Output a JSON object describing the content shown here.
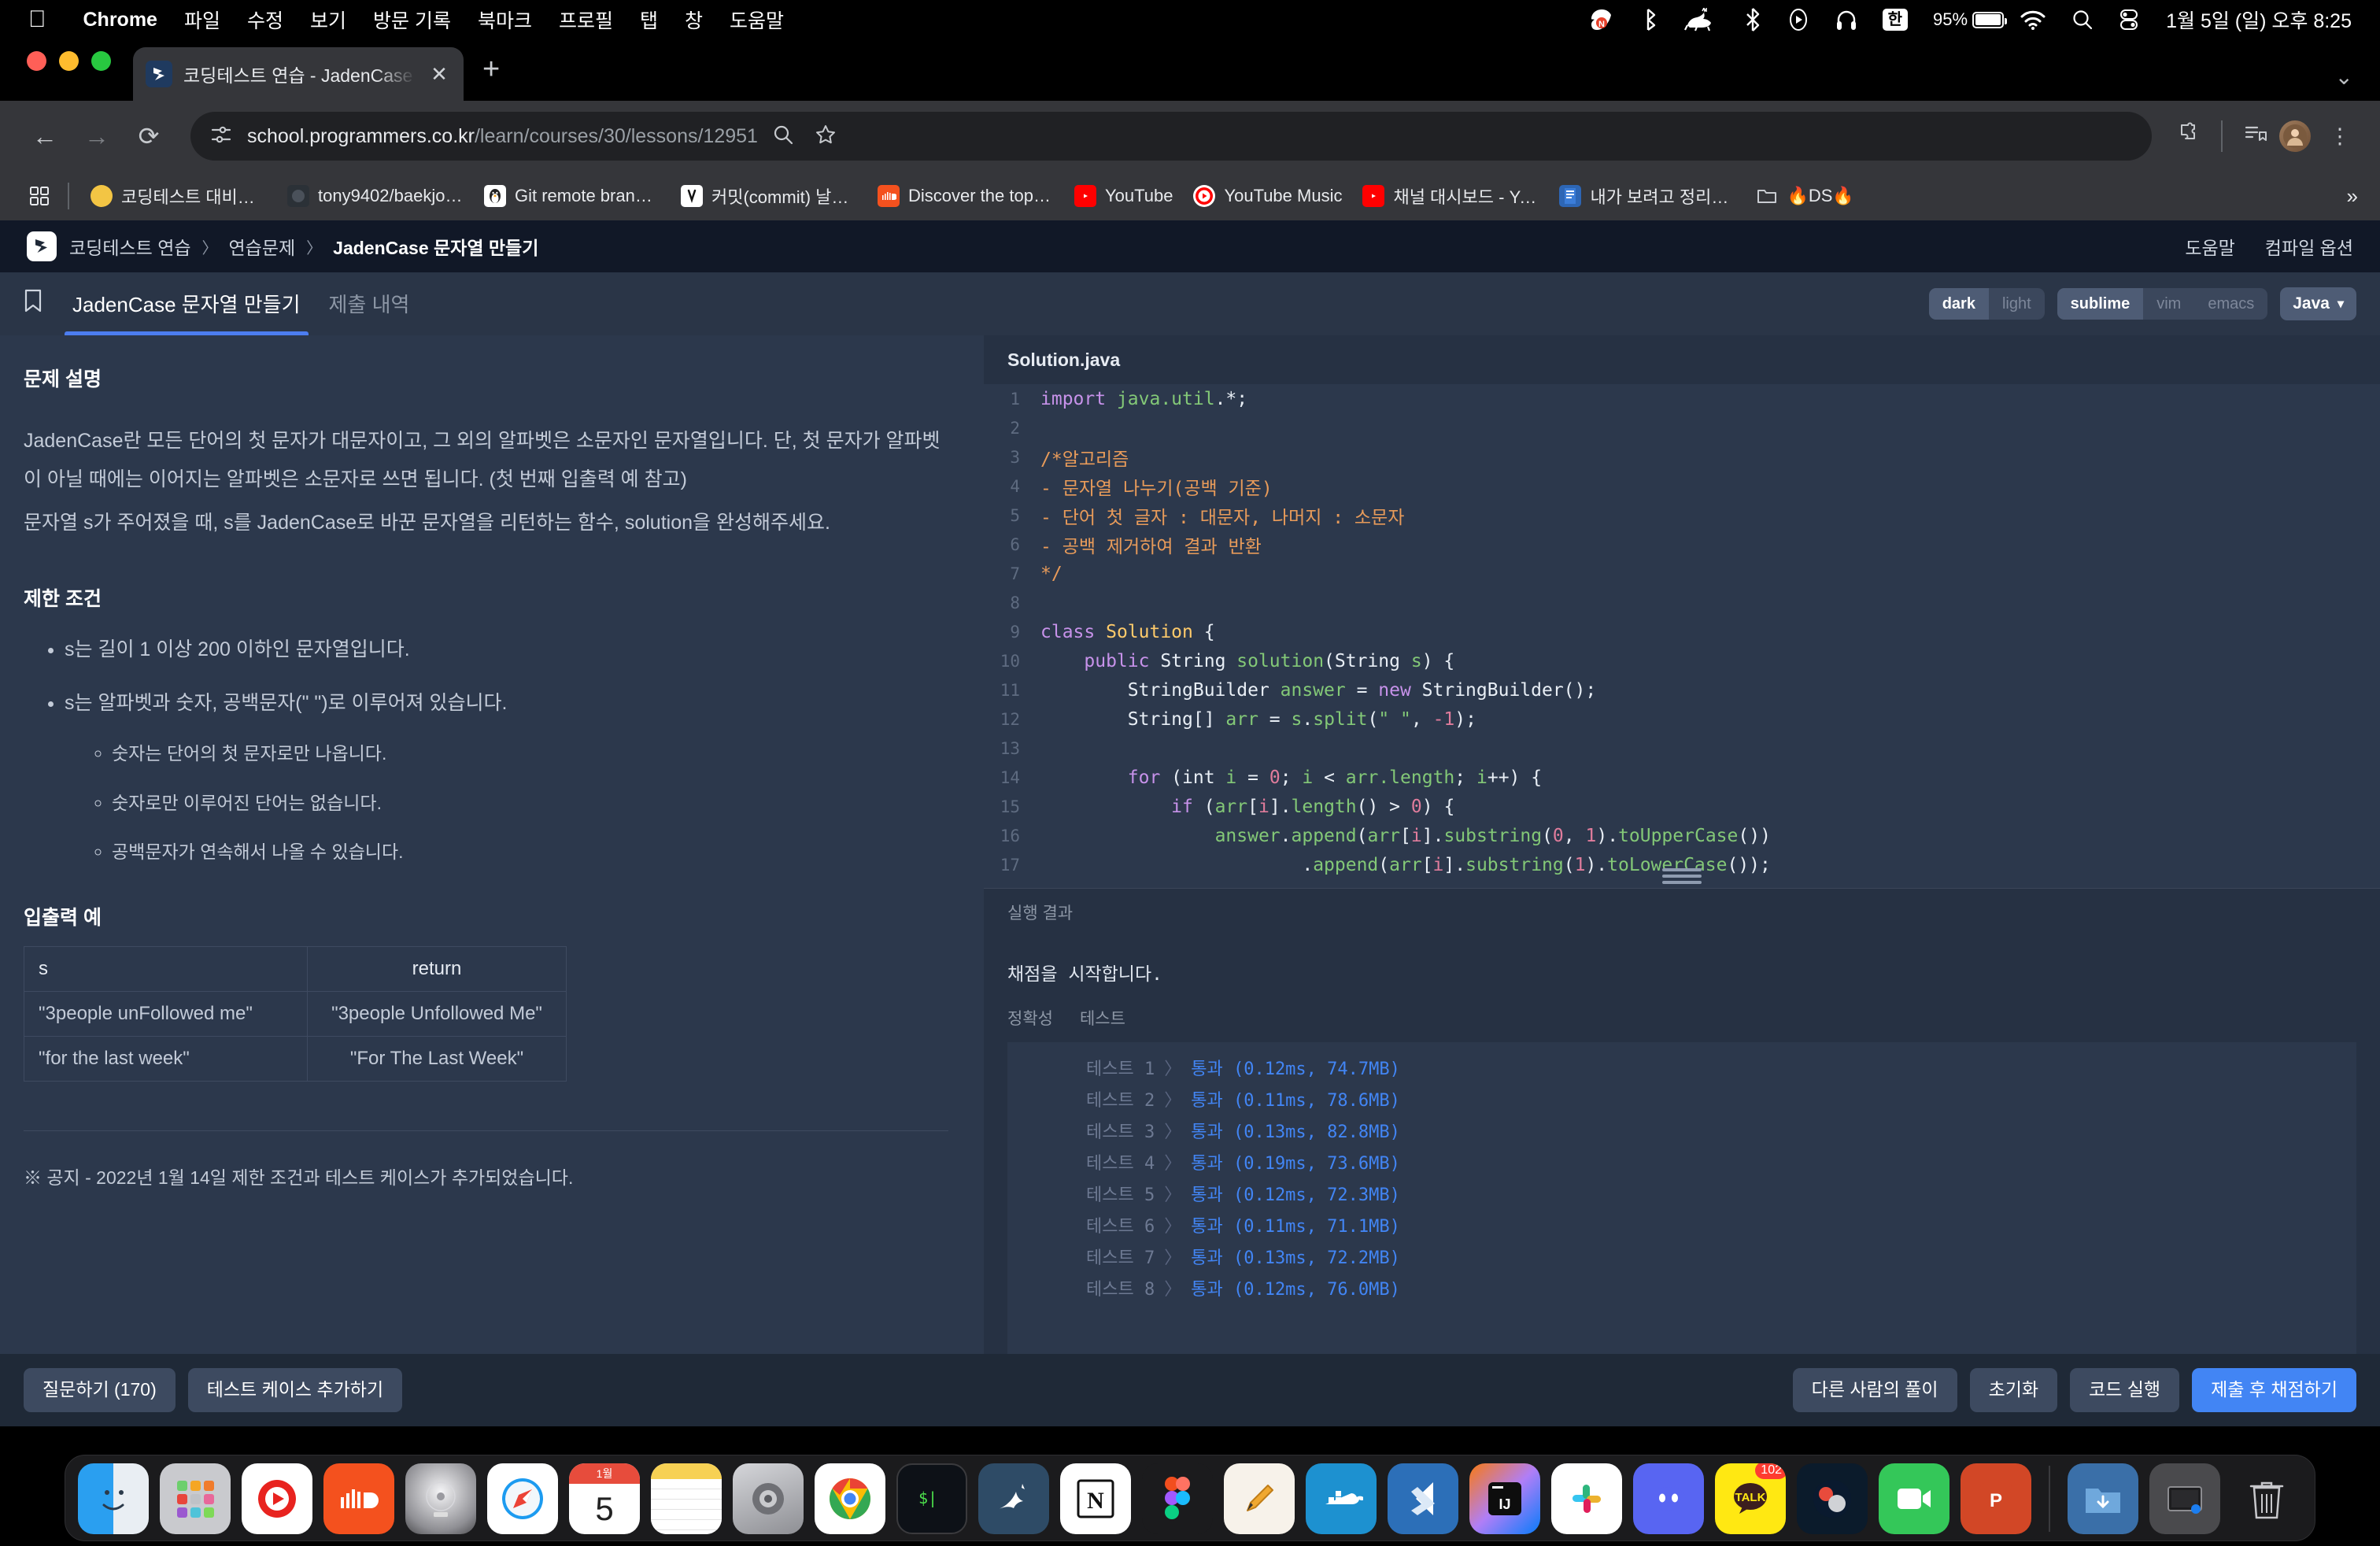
{
  "menubar": {
    "apple_icon": "apple-icon",
    "app_name": "Chrome",
    "items": [
      "파일",
      "수정",
      "보기",
      "방문 기록",
      "북마크",
      "프로필",
      "탭",
      "창",
      "도움말"
    ],
    "status_icons": [
      "naver-whale-icon",
      "bluetooth-tray-icon",
      "cat-runner-icon",
      "bluetooth-icon",
      "play-icon",
      "headphones-icon"
    ],
    "ime": "한",
    "battery_percent": "95%",
    "clock": "1월 5일 (일) 오후 8:25"
  },
  "chrome": {
    "tab": {
      "title": "코딩테스트 연습 - JadenCase 문자열 만들기",
      "close_label": "✕"
    },
    "new_tab_label": "+",
    "window_chevron": "⌄",
    "toolbar": {
      "back": "←",
      "forward": "→",
      "reload": "⟳",
      "url_host": "school.programmers.co.kr",
      "url_path": "/learn/courses/30/lessons/12951",
      "zoom_icon": "search-page-icon",
      "bookmark_icon": "star-icon",
      "extensions_icon": "puzzle-icon",
      "readinglist_icon": "reading-list-icon",
      "profile_initial": "",
      "menu_icon": "⋮"
    },
    "bookmarks": [
      {
        "label": "코딩테스트 대비를 위…",
        "icon": "yellow-circle"
      },
      {
        "label": "tony9402/baekjoo…",
        "icon": "github-icon"
      },
      {
        "label": "Git remote branch…",
        "icon": "tistory-penguin"
      },
      {
        "label": "커밋(commit) 날짜…",
        "icon": "velog-icon"
      },
      {
        "label": "Discover the top s…",
        "icon": "soundcloud-icon"
      },
      {
        "label": "YouTube",
        "icon": "youtube-icon"
      },
      {
        "label": "YouTube Music",
        "icon": "youtube-music-icon"
      },
      {
        "label": "채널 대시보드 - YouT…",
        "icon": "youtube-icon"
      },
      {
        "label": "내가 보려고 정리한 정…",
        "icon": "book-icon"
      },
      {
        "label": "🔥DS🔥",
        "icon": "folder-icon"
      }
    ],
    "bookmarks_overflow": "»"
  },
  "site": {
    "breadcrumbs": [
      "코딩테스트 연습",
      "연습문제",
      "JadenCase 문자열 만들기"
    ],
    "crumb_separator": "〉",
    "header_links": [
      "도움말",
      "컴파일 옵션"
    ],
    "tabs": [
      {
        "label": "JadenCase 문자열 만들기",
        "active": true
      },
      {
        "label": "제출 내역",
        "active": false
      }
    ],
    "bookmark_icon": "bookmark-icon",
    "editor_options": {
      "theme": {
        "options": [
          "dark",
          "light"
        ],
        "selected": "dark"
      },
      "keymap": {
        "options": [
          "sublime",
          "vim",
          "emacs"
        ],
        "selected": "sublime"
      },
      "language": "Java",
      "language_caret": "▾"
    }
  },
  "problem": {
    "description_title": "문제 설명",
    "description_paragraphs": [
      "JadenCase란 모든 단어의 첫 문자가 대문자이고, 그 외의 알파벳은 소문자인 문자열입니다. 단, 첫 문자가 알파벳이 아닐 때에는 이어지는 알파벳은 소문자로 쓰면 됩니다. (첫 번째 입출력 예 참고)",
      "문자열 s가 주어졌을 때, s를 JadenCase로 바꾼 문자열을 리턴하는 함수, solution을 완성해주세요."
    ],
    "constraints_title": "제한 조건",
    "constraints": [
      {
        "text": "s는 길이 1 이상 200 이하인 문자열입니다.",
        "sub": []
      },
      {
        "text": "s는 알파벳과 숫자, 공백문자(\" \")로 이루어져 있습니다.",
        "sub": [
          "숫자는 단어의 첫 문자로만 나옵니다.",
          "숫자로만 이루어진 단어는 없습니다.",
          "공백문자가 연속해서 나올 수 있습니다."
        ]
      }
    ],
    "io_title": "입출력 예",
    "io_headers": [
      "s",
      "return"
    ],
    "io_rows": [
      [
        "\"3people unFollowed me\"",
        "\"3people Unfollowed Me\""
      ],
      [
        "\"for the last week\"",
        "\"For The Last Week\""
      ]
    ],
    "notice": "※ 공지 - 2022년 1월 14일 제한 조건과 테스트 케이스가 추가되었습니다."
  },
  "editor": {
    "filename": "Solution.java",
    "lines": [
      {
        "n": "1",
        "tokens": [
          {
            "t": "import ",
            "c": "k-key"
          },
          {
            "t": "java.util",
            "c": "k-pkg"
          },
          {
            "t": ".*;",
            "c": "k-pln"
          }
        ]
      },
      {
        "n": "2",
        "tokens": []
      },
      {
        "n": "3",
        "tokens": [
          {
            "t": "/*알고리즘",
            "c": "k-cmt"
          }
        ]
      },
      {
        "n": "4",
        "tokens": [
          {
            "t": "- 문자열 나누기(공백 기준)",
            "c": "k-cmt"
          }
        ]
      },
      {
        "n": "5",
        "tokens": [
          {
            "t": "- 단어 첫 글자 : 대문자, 나머지 : 소문자",
            "c": "k-cmt"
          }
        ]
      },
      {
        "n": "6",
        "tokens": [
          {
            "t": "- 공백 제거하여 결과 반환",
            "c": "k-cmt"
          }
        ]
      },
      {
        "n": "7",
        "tokens": [
          {
            "t": "*/",
            "c": "k-cmt"
          }
        ]
      },
      {
        "n": "8",
        "tokens": []
      },
      {
        "n": "9",
        "tokens": [
          {
            "t": "class ",
            "c": "k-key"
          },
          {
            "t": "Solution",
            "c": "k-cls"
          },
          {
            "t": " {",
            "c": "k-pln"
          }
        ]
      },
      {
        "n": "10",
        "tokens": [
          {
            "t": "    ",
            "c": "k-pln"
          },
          {
            "t": "public ",
            "c": "k-key"
          },
          {
            "t": "String ",
            "c": "k-pln"
          },
          {
            "t": "solution",
            "c": "k-fn"
          },
          {
            "t": "(String ",
            "c": "k-pln"
          },
          {
            "t": "s",
            "c": "k-fn"
          },
          {
            "t": ") {",
            "c": "k-pln"
          }
        ]
      },
      {
        "n": "11",
        "tokens": [
          {
            "t": "        StringBuilder ",
            "c": "k-pln"
          },
          {
            "t": "answer",
            "c": "k-fn"
          },
          {
            "t": " = ",
            "c": "k-pln"
          },
          {
            "t": "new ",
            "c": "k-key"
          },
          {
            "t": "StringBuilder();",
            "c": "k-pln"
          }
        ]
      },
      {
        "n": "12",
        "tokens": [
          {
            "t": "        String[] ",
            "c": "k-pln"
          },
          {
            "t": "arr",
            "c": "k-fn"
          },
          {
            "t": " = ",
            "c": "k-pln"
          },
          {
            "t": "s",
            "c": "k-fn"
          },
          {
            "t": ".",
            "c": "k-pln"
          },
          {
            "t": "split",
            "c": "k-fn"
          },
          {
            "t": "(",
            "c": "k-pln"
          },
          {
            "t": "\" \"",
            "c": "k-str"
          },
          {
            "t": ", ",
            "c": "k-pln"
          },
          {
            "t": "-1",
            "c": "k-num"
          },
          {
            "t": ");",
            "c": "k-pln"
          }
        ]
      },
      {
        "n": "13",
        "tokens": []
      },
      {
        "n": "14",
        "tokens": [
          {
            "t": "        ",
            "c": "k-pln"
          },
          {
            "t": "for ",
            "c": "k-key"
          },
          {
            "t": "(int ",
            "c": "k-pln"
          },
          {
            "t": "i",
            "c": "k-fn"
          },
          {
            "t": " = ",
            "c": "k-pln"
          },
          {
            "t": "0",
            "c": "k-num"
          },
          {
            "t": "; ",
            "c": "k-pln"
          },
          {
            "t": "i",
            "c": "k-fn"
          },
          {
            "t": " < ",
            "c": "k-pln"
          },
          {
            "t": "arr.length",
            "c": "k-fn"
          },
          {
            "t": "; ",
            "c": "k-pln"
          },
          {
            "t": "i",
            "c": "k-fn"
          },
          {
            "t": "++) {",
            "c": "k-pln"
          }
        ]
      },
      {
        "n": "15",
        "tokens": [
          {
            "t": "            ",
            "c": "k-pln"
          },
          {
            "t": "if ",
            "c": "k-key"
          },
          {
            "t": "(",
            "c": "k-pln"
          },
          {
            "t": "arr",
            "c": "k-fn"
          },
          {
            "t": "[",
            "c": "k-pln"
          },
          {
            "t": "i",
            "c": "k-num"
          },
          {
            "t": "].",
            "c": "k-pln"
          },
          {
            "t": "length",
            "c": "k-fn"
          },
          {
            "t": "() > ",
            "c": "k-pln"
          },
          {
            "t": "0",
            "c": "k-num"
          },
          {
            "t": ") {",
            "c": "k-pln"
          }
        ]
      },
      {
        "n": "16",
        "tokens": [
          {
            "t": "                ",
            "c": "k-pln"
          },
          {
            "t": "answer",
            "c": "k-fn"
          },
          {
            "t": ".",
            "c": "k-pln"
          },
          {
            "t": "append",
            "c": "k-fn"
          },
          {
            "t": "(",
            "c": "k-pln"
          },
          {
            "t": "arr",
            "c": "k-fn"
          },
          {
            "t": "[",
            "c": "k-pln"
          },
          {
            "t": "i",
            "c": "k-num"
          },
          {
            "t": "].",
            "c": "k-pln"
          },
          {
            "t": "substring",
            "c": "k-fn"
          },
          {
            "t": "(",
            "c": "k-pln"
          },
          {
            "t": "0",
            "c": "k-num"
          },
          {
            "t": ", ",
            "c": "k-pln"
          },
          {
            "t": "1",
            "c": "k-num"
          },
          {
            "t": ").",
            "c": "k-pln"
          },
          {
            "t": "toUpperCase",
            "c": "k-fn"
          },
          {
            "t": "())",
            "c": "k-pln"
          }
        ]
      },
      {
        "n": "17",
        "tokens": [
          {
            "t": "                        .",
            "c": "k-pln"
          },
          {
            "t": "append",
            "c": "k-fn"
          },
          {
            "t": "(",
            "c": "k-pln"
          },
          {
            "t": "arr",
            "c": "k-fn"
          },
          {
            "t": "[",
            "c": "k-pln"
          },
          {
            "t": "i",
            "c": "k-num"
          },
          {
            "t": "].",
            "c": "k-pln"
          },
          {
            "t": "substring",
            "c": "k-fn"
          },
          {
            "t": "(",
            "c": "k-pln"
          },
          {
            "t": "1",
            "c": "k-num"
          },
          {
            "t": ").",
            "c": "k-pln"
          },
          {
            "t": "toLowerCase",
            "c": "k-fn"
          },
          {
            "t": "());",
            "c": "k-pln"
          }
        ]
      }
    ]
  },
  "results": {
    "panel_title": "실행 결과",
    "message": "채점을 시작합니다.",
    "tabs": [
      "정확성",
      "테스트"
    ],
    "rows": [
      {
        "name": "테스트 1",
        "arrow": "〉",
        "status": "통과 (0.12ms, 74.7MB)"
      },
      {
        "name": "테스트 2",
        "arrow": "〉",
        "status": "통과 (0.11ms, 78.6MB)"
      },
      {
        "name": "테스트 3",
        "arrow": "〉",
        "status": "통과 (0.13ms, 82.8MB)"
      },
      {
        "name": "테스트 4",
        "arrow": "〉",
        "status": "통과 (0.19ms, 73.6MB)"
      },
      {
        "name": "테스트 5",
        "arrow": "〉",
        "status": "통과 (0.12ms, 72.3MB)"
      },
      {
        "name": "테스트 6",
        "arrow": "〉",
        "status": "통과 (0.11ms, 71.1MB)"
      },
      {
        "name": "테스트 7",
        "arrow": "〉",
        "status": "통과 (0.13ms, 72.2MB)"
      },
      {
        "name": "테스트 8",
        "arrow": "〉",
        "status": "통과 (0.12ms, 76.0MB)"
      }
    ]
  },
  "actions": {
    "left": [
      "질문하기 (170)",
      "테스트 케이스 추가하기"
    ],
    "right": [
      "다른 사람의 풀이",
      "초기화",
      "코드 실행"
    ],
    "primary": "제출 후 채점하기"
  },
  "dock": {
    "items": [
      {
        "name": "finder-icon",
        "running": true
      },
      {
        "name": "launchpad-icon",
        "running": false
      },
      {
        "name": "youtube-music-desktop-icon",
        "running": false
      },
      {
        "name": "soundcloud-icon",
        "running": false
      },
      {
        "name": "itunes-icon",
        "running": false
      },
      {
        "name": "safari-icon",
        "running": false
      },
      {
        "name": "calendar-icon",
        "running": false,
        "day": "5",
        "month": "1월"
      },
      {
        "name": "notes-icon",
        "running": false
      },
      {
        "name": "system-preferences-icon",
        "running": true
      },
      {
        "name": "chrome-icon",
        "running": true
      },
      {
        "name": "terminal-icon",
        "running": false
      },
      {
        "name": "mysql-workbench-icon",
        "running": true
      },
      {
        "name": "notion-icon",
        "running": true
      },
      {
        "name": "figma-icon",
        "running": false
      },
      {
        "name": "pencil-app-icon",
        "running": false
      },
      {
        "name": "docker-icon",
        "running": false
      },
      {
        "name": "vscode-icon",
        "running": false
      },
      {
        "name": "intellij-idea-icon",
        "running": false
      },
      {
        "name": "slack-icon",
        "running": false
      },
      {
        "name": "discord-icon",
        "running": false
      },
      {
        "name": "kakaotalk-icon",
        "running": false,
        "badge": "102"
      },
      {
        "name": "photoshop-icon",
        "running": false
      },
      {
        "name": "facetime-icon",
        "running": false
      },
      {
        "name": "powerpoint-icon",
        "running": false
      },
      {
        "name": "downloads-folder-icon",
        "running": false
      },
      {
        "name": "screenshots-folder-icon",
        "running": false
      },
      {
        "name": "trash-icon",
        "running": false
      }
    ]
  }
}
